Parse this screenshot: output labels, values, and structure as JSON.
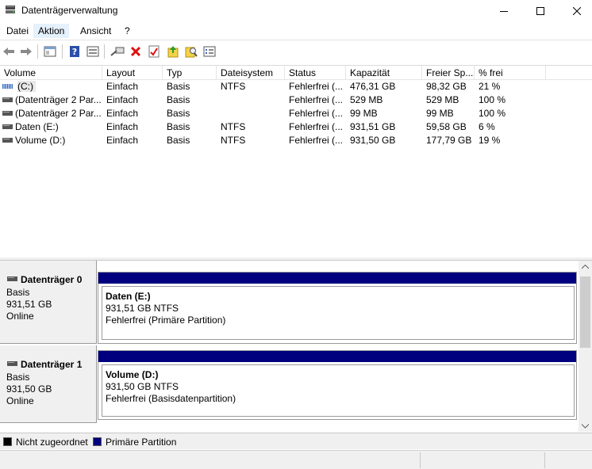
{
  "window": {
    "title": "Datenträgerverwaltung"
  },
  "menu": {
    "items": [
      "Datei",
      "Aktion",
      "Ansicht",
      "?"
    ]
  },
  "toolbar": {
    "icons": [
      "back-icon",
      "forward-icon",
      "console-icon",
      "help-icon",
      "properties-icon",
      "connect-icon",
      "delete-icon",
      "check-icon",
      "import-icon",
      "search-icon",
      "list-icon"
    ]
  },
  "volumes": {
    "columns": [
      "Volume",
      "Layout",
      "Typ",
      "Dateisystem",
      "Status",
      "Kapazität",
      "Freier Sp...",
      "% frei"
    ],
    "rows": [
      {
        "volume": "(C:)",
        "layout": "Einfach",
        "typ": "Basis",
        "fs": "NTFS",
        "status": "Fehlerfrei (...",
        "cap": "476,31 GB",
        "free": "98,32 GB",
        "pct": "21 %"
      },
      {
        "volume": "(Datenträger 2 Par...",
        "layout": "Einfach",
        "typ": "Basis",
        "fs": "",
        "status": "Fehlerfrei (...",
        "cap": "529 MB",
        "free": "529 MB",
        "pct": "100 %"
      },
      {
        "volume": "(Datenträger 2 Par...",
        "layout": "Einfach",
        "typ": "Basis",
        "fs": "",
        "status": "Fehlerfrei (...",
        "cap": "99 MB",
        "free": "99 MB",
        "pct": "100 %"
      },
      {
        "volume": "Daten (E:)",
        "layout": "Einfach",
        "typ": "Basis",
        "fs": "NTFS",
        "status": "Fehlerfrei (...",
        "cap": "931,51 GB",
        "free": "59,58 GB",
        "pct": "6 %"
      },
      {
        "volume": "Volume (D:)",
        "layout": "Einfach",
        "typ": "Basis",
        "fs": "NTFS",
        "status": "Fehlerfrei (...",
        "cap": "931,50 GB",
        "free": "177,79 GB",
        "pct": "19 %"
      }
    ]
  },
  "disks": [
    {
      "name": "Datenträger 0",
      "type": "Basis",
      "size": "931,51 GB",
      "state": "Online",
      "partition": {
        "title": "Daten  (E:)",
        "size": "931,51 GB NTFS",
        "status": "Fehlerfrei (Primäre Partition)"
      }
    },
    {
      "name": "Datenträger 1",
      "type": "Basis",
      "size": "931,50 GB",
      "state": "Online",
      "partition": {
        "title": "Volume  (D:)",
        "size": "931,50 GB NTFS",
        "status": "Fehlerfrei (Basisdatenpartition)"
      }
    }
  ],
  "legend": {
    "unallocated": "Nicht zugeordnet",
    "primary": "Primäre Partition",
    "unallocated_color": "#000000",
    "primary_color": "#00007f"
  }
}
